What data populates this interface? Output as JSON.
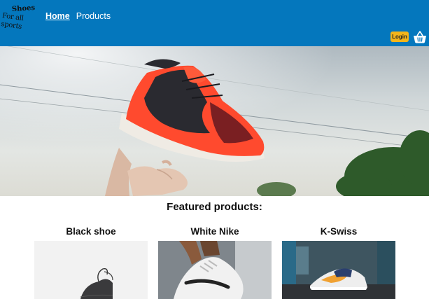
{
  "header": {
    "logo": {
      "line1": "Shoes",
      "line2": "For all sports"
    },
    "nav": [
      {
        "label": "Home",
        "active": true
      },
      {
        "label": "Products",
        "active": false
      }
    ],
    "login_label": "Login",
    "basket_icon": "basket-icon",
    "background_color": "#0477bd",
    "login_color": "#f3b51b"
  },
  "hero": {
    "image": "red-sneaker-hero-photo"
  },
  "featured": {
    "title": "Featured products:",
    "products": [
      {
        "name": "Black shoe"
      },
      {
        "name": "White Nike"
      },
      {
        "name": "K-Swiss"
      }
    ]
  }
}
